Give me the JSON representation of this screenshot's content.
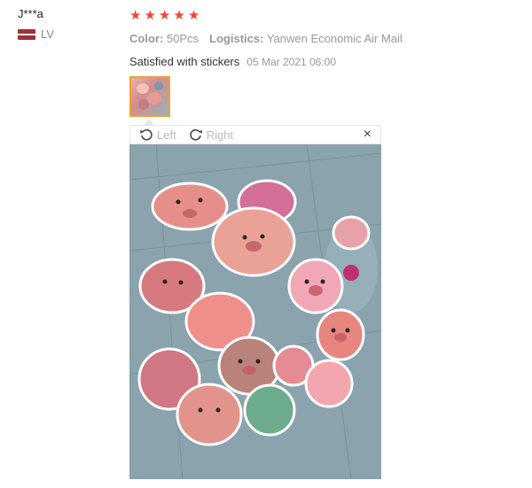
{
  "reviewer": {
    "name": "J***a",
    "country": "LV",
    "flag_colors": [
      "#9e3039",
      "#ffffff",
      "#9e3039"
    ]
  },
  "review": {
    "rating": 5,
    "stars": [
      "★",
      "★",
      "★",
      "★",
      "★"
    ],
    "color_label": "Color:",
    "color_value": "50Pcs",
    "logistics_label": "Logistics:",
    "logistics_value": "Yanwen Economic Air Mail",
    "text": "Satisfied with stickers",
    "date": "05 Mar 2021 06:00"
  },
  "viewer": {
    "rotate_left_label": "Left",
    "rotate_right_label": "Right",
    "close_glyph": "×",
    "icons": {
      "rotate_left": "rotate-left-icon",
      "rotate_right": "rotate-right-icon",
      "close": "close-icon"
    }
  },
  "colors": {
    "star": "#f44336",
    "thumb_border": "#f0a030"
  }
}
